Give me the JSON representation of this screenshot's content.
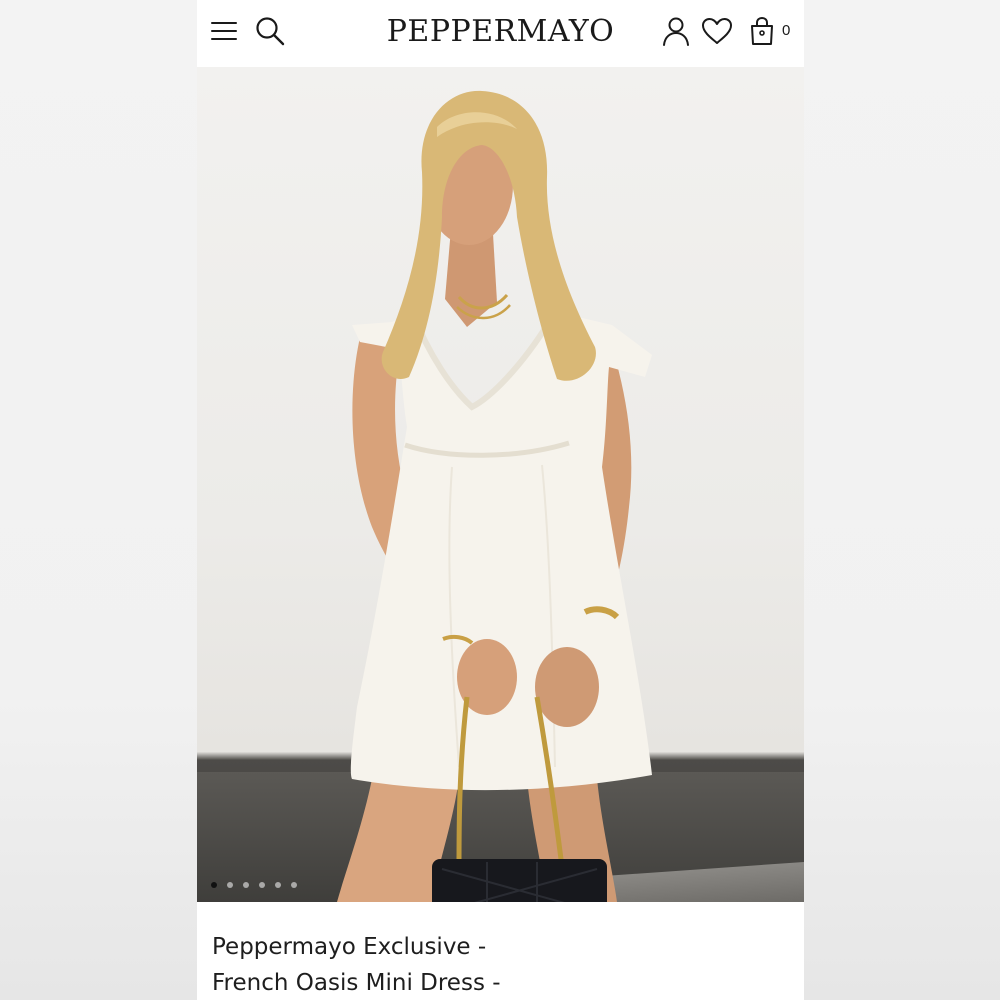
{
  "header": {
    "brand": "PEPPERMAYO",
    "cart_count": "0",
    "icons": [
      "menu-icon",
      "search-icon",
      "account-icon",
      "wishlist-icon",
      "bag-icon"
    ]
  },
  "gallery": {
    "slide_count": 6,
    "active_slide": 1
  },
  "product": {
    "title_line_1": "Peppermayo Exclusive -",
    "title_line_2": "French Oasis Mini Dress -"
  },
  "colors": {
    "text": "#1a1a1a",
    "background": "#ffffff",
    "dress": "#f6f3ec",
    "hair": "#d9b876"
  }
}
